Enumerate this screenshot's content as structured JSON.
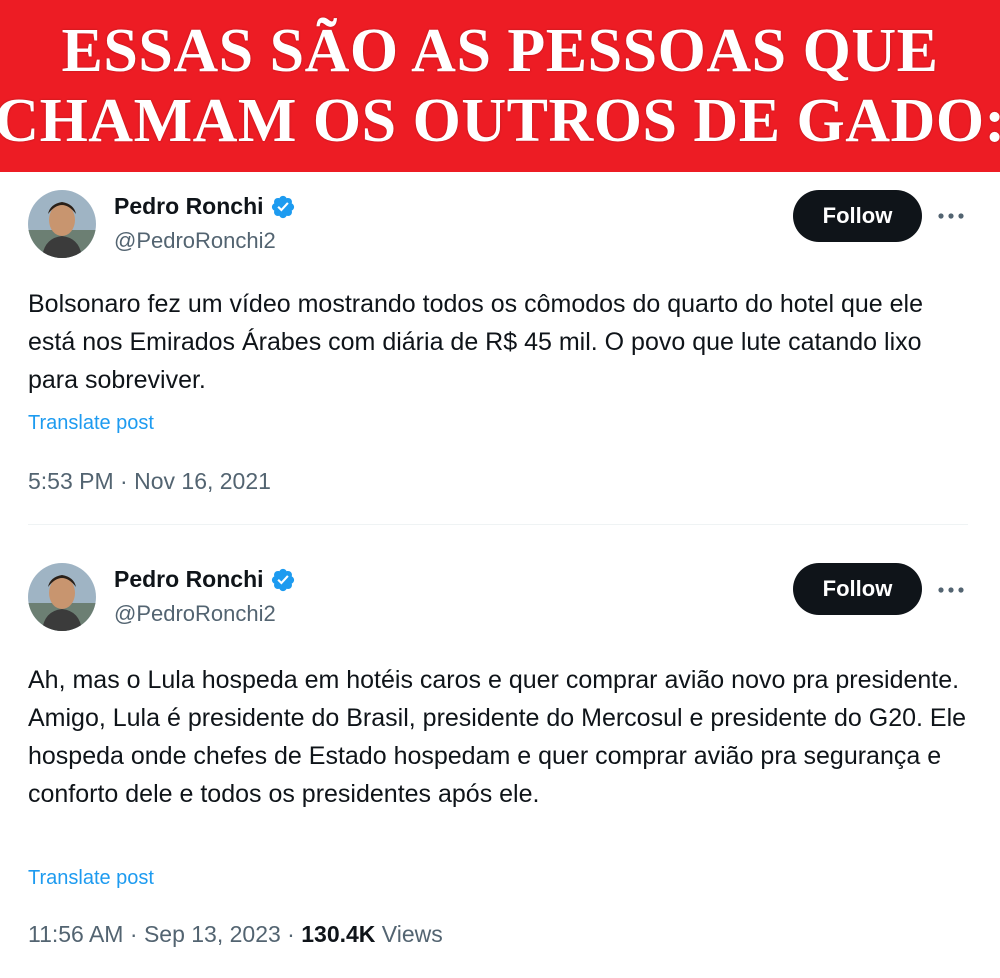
{
  "banner": {
    "line1": "ESSAS SÃO AS PESSOAS QUE",
    "line2": "CHAMAM OS OUTROS DE GADO:"
  },
  "colors": {
    "banner_red": "#ed1c24",
    "verified_blue": "#1d9bf0",
    "link_blue": "#1d9bf0"
  },
  "tweets": [
    {
      "author_name": "Pedro Ronchi",
      "handle": "@PedroRonchi2",
      "follow_label": "Follow",
      "more_icon": "more-horizontal-icon",
      "text": "Bolsonaro fez um vídeo mostrando todos os cômodos do quarto do hotel que ele está nos Emirados Árabes com diária de R$ 45 mil. O povo que lute catando lixo para sobreviver.",
      "translate_label": "Translate post",
      "time": "5:53 PM",
      "date": "Nov 16, 2021"
    },
    {
      "author_name": "Pedro Ronchi",
      "handle": "@PedroRonchi2",
      "follow_label": "Follow",
      "more_icon": "more-horizontal-icon",
      "text": "Ah, mas o Lula hospeda em hotéis caros e quer comprar avião novo pra presidente. Amigo, Lula é presidente do Brasil, presidente do Mercosul e presidente do G20. Ele hospeda onde chefes de Estado hospedam e quer comprar avião pra segurança e conforto dele e todos os presidentes após ele.",
      "translate_label": "Translate post",
      "time": "11:56 AM",
      "date": "Sep 13, 2023",
      "views_count": "130.4K",
      "views_label": "Views"
    }
  ]
}
